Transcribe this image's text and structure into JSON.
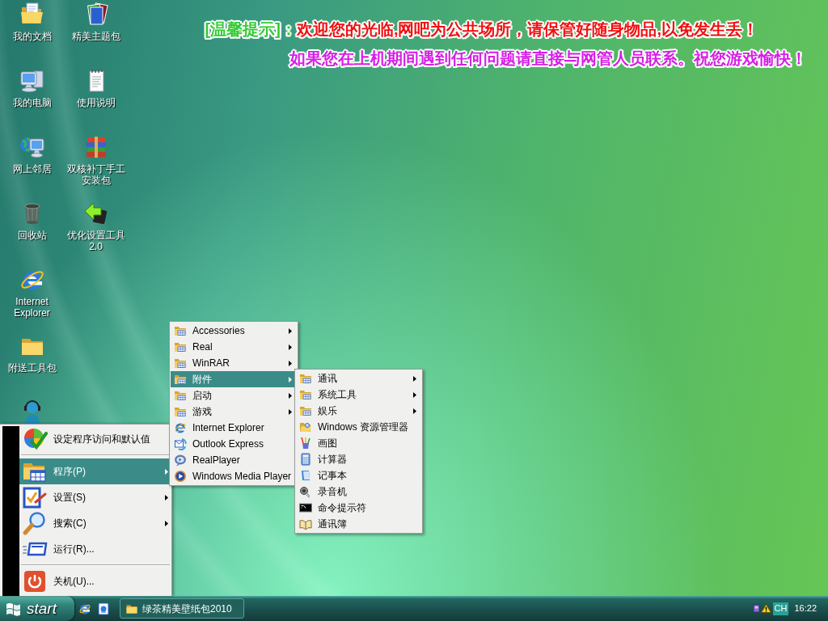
{
  "desktop": {
    "icons": [
      {
        "kind": "documents",
        "label": "我的文档"
      },
      {
        "kind": "computer",
        "label": "我的电脑"
      },
      {
        "kind": "network",
        "label": "网上邻居"
      },
      {
        "kind": "bin",
        "label": "回收站"
      },
      {
        "kind": "browser",
        "label": "Internet Explorer"
      },
      {
        "kind": "folder",
        "label": "附送工具包"
      },
      {
        "kind": "messenger"
      },
      {
        "kind": "pictures",
        "label": "精美主题包"
      },
      {
        "kind": "notes",
        "label": "使用说明"
      },
      {
        "kind": "archive",
        "label": "双核补丁手工安装包"
      },
      {
        "kind": "tool",
        "label": "优化设置工具 2.0"
      }
    ]
  },
  "notice": {
    "lines": [
      {
        "segments": [
          {
            "text": "[温馨提示]：",
            "color": "#33cc33"
          },
          {
            "text": "欢迎您的光临,网吧为公共场所，请保管好随身物品,以免发生丢！",
            "color": "#f01010"
          }
        ]
      },
      {
        "segments": [
          {
            "text": "如果您在上机期间遇到任何问题请直接与网管人员联系。祝您游戏愉快！",
            "color": "#d61ee6"
          }
        ]
      }
    ]
  },
  "start_menu": {
    "items": [
      {
        "kind": "defaults",
        "label": "设定程序访问和默认值",
        "submenu": false,
        "selected": false
      },
      {
        "kind": "separator"
      },
      {
        "kind": "programs",
        "label": "程序(P)",
        "submenu": true,
        "selected": true
      },
      {
        "kind": "settings",
        "label": "设置(S)",
        "submenu": true,
        "selected": false
      },
      {
        "kind": "search",
        "label": "搜索(C)",
        "submenu": true,
        "selected": false
      },
      {
        "kind": "run",
        "label": "运行(R)...",
        "submenu": false,
        "selected": false
      },
      {
        "kind": "separator"
      },
      {
        "kind": "shutdown",
        "label": "关机(U)...",
        "submenu": false,
        "selected": false
      }
    ]
  },
  "programs_menu": {
    "items": [
      {
        "kind": "folder",
        "label": "Accessories",
        "submenu": true,
        "selected": false
      },
      {
        "kind": "folder",
        "label": "Real",
        "submenu": true,
        "selected": false
      },
      {
        "kind": "folder",
        "label": "WinRAR",
        "submenu": true,
        "selected": false
      },
      {
        "kind": "folder",
        "label": "附件",
        "submenu": true,
        "selected": true
      },
      {
        "kind": "folder",
        "label": "启动",
        "submenu": true,
        "selected": false
      },
      {
        "kind": "folder",
        "label": "游戏",
        "submenu": true,
        "selected": false
      },
      {
        "kind": "browser",
        "label": "Internet Explorer",
        "submenu": false,
        "selected": false
      },
      {
        "kind": "mail",
        "label": "Outlook Express",
        "submenu": false,
        "selected": false
      },
      {
        "kind": "realplayer",
        "label": "RealPlayer",
        "submenu": false,
        "selected": false
      },
      {
        "kind": "mediaplayer",
        "label": "Windows Media Player",
        "submenu": false,
        "selected": false
      }
    ]
  },
  "accessories_menu": {
    "items": [
      {
        "kind": "folder",
        "label": "通讯",
        "submenu": true,
        "selected": false
      },
      {
        "kind": "folder",
        "label": "系统工具",
        "submenu": true,
        "selected": false
      },
      {
        "kind": "folder",
        "label": "娱乐",
        "submenu": true,
        "selected": false
      },
      {
        "kind": "explorer",
        "label": "Windows 资源管理器",
        "submenu": false,
        "selected": false
      },
      {
        "kind": "paint",
        "label": "画图",
        "submenu": false,
        "selected": false
      },
      {
        "kind": "calculator",
        "label": "计算器",
        "submenu": false,
        "selected": false
      },
      {
        "kind": "notepad",
        "label": "记事本",
        "submenu": false,
        "selected": false
      },
      {
        "kind": "recorder",
        "label": "录音机",
        "submenu": false,
        "selected": false
      },
      {
        "kind": "console",
        "label": "命令提示符",
        "submenu": false,
        "selected": false
      },
      {
        "kind": "addressbook",
        "label": "通讯簿",
        "submenu": false,
        "selected": false
      }
    ]
  },
  "taskbar": {
    "start_label": "start",
    "tasks": [
      {
        "label": "绿茶精美壁纸包2010",
        "selected": false
      }
    ],
    "tray": {
      "language": "CH",
      "clock": "16:22"
    }
  }
}
